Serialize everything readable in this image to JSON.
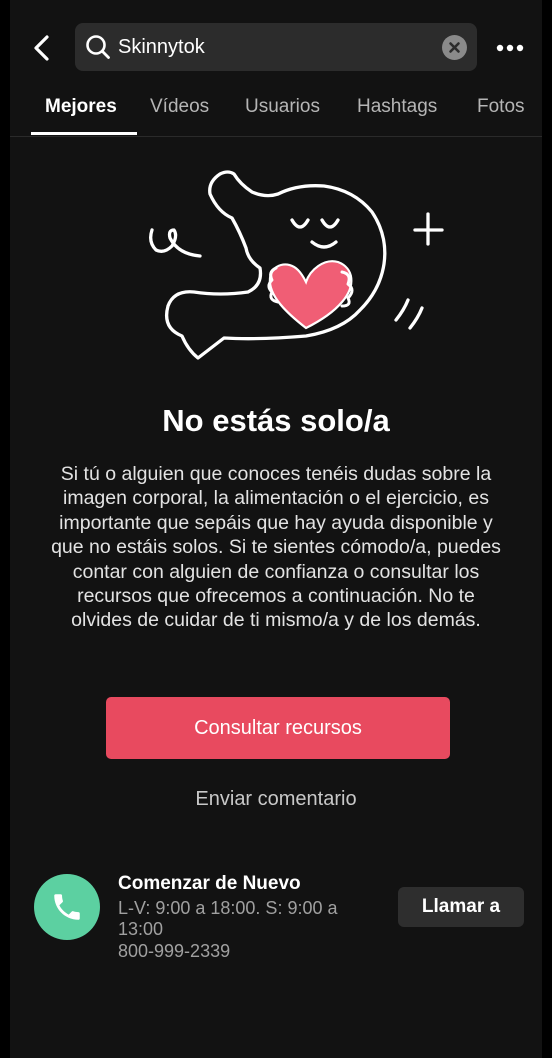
{
  "search": {
    "query": "Skinnytok"
  },
  "icons": {
    "back": "chevron-left-icon",
    "search": "search-icon",
    "clear": "clear-icon",
    "more": "more-icon",
    "phone": "phone-icon"
  },
  "tabs": [
    {
      "label": "Mejores",
      "active": true
    },
    {
      "label": "Vídeos",
      "active": false
    },
    {
      "label": "Usuarios",
      "active": false
    },
    {
      "label": "Hashtags",
      "active": false
    },
    {
      "label": "Fotos",
      "active": false
    }
  ],
  "content": {
    "title": "No estás solo/a",
    "body": "Si tú o alguien que conoces tenéis dudas sobre la imagen corporal, la alimentación o el ejercicio, es importante que sepáis que hay ayuda disponible y que no estáis solos. Si te sientes cómodo/a, puedes contar con alguien de confianza o consultar los recursos que ofrecemos a continuación. No te olvides de cuidar de ti mismo/a y de los demás.",
    "primary_button": "Consultar recursos",
    "secondary_link": "Enviar comentario"
  },
  "contact": {
    "name": "Comenzar de Nuevo",
    "hours": "L-V: 9:00 a 18:00. S: 9:00 a 13:00",
    "phone": "800-999-2339",
    "call_button": "Llamar a"
  },
  "colors": {
    "background": "#121212",
    "accent": "#e84a5f",
    "heart": "#f05e75",
    "phone_avatar": "#5cd0a1"
  }
}
